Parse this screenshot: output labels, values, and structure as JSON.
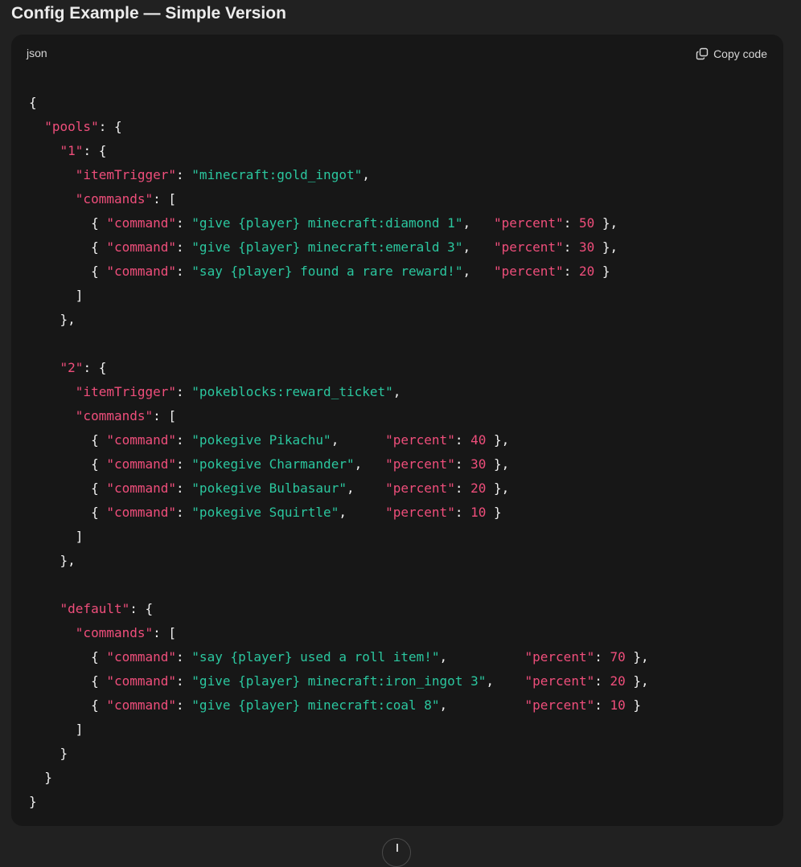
{
  "heading": "Config Example — Simple Version",
  "code_block": {
    "language": "json",
    "copy_label": "Copy code",
    "lines": [
      [
        {
          "t": "punc",
          "v": "{"
        }
      ],
      [
        {
          "t": "punc",
          "v": "  "
        },
        {
          "t": "key",
          "v": "\"pools\""
        },
        {
          "t": "punc",
          "v": ": {"
        }
      ],
      [
        {
          "t": "punc",
          "v": "    "
        },
        {
          "t": "key",
          "v": "\"1\""
        },
        {
          "t": "punc",
          "v": ": {"
        }
      ],
      [
        {
          "t": "punc",
          "v": "      "
        },
        {
          "t": "key",
          "v": "\"itemTrigger\""
        },
        {
          "t": "punc",
          "v": ": "
        },
        {
          "t": "str",
          "v": "\"minecraft:gold_ingot\""
        },
        {
          "t": "punc",
          "v": ","
        }
      ],
      [
        {
          "t": "punc",
          "v": "      "
        },
        {
          "t": "key",
          "v": "\"commands\""
        },
        {
          "t": "punc",
          "v": ": ["
        }
      ],
      [
        {
          "t": "punc",
          "v": "        { "
        },
        {
          "t": "key",
          "v": "\"command\""
        },
        {
          "t": "punc",
          "v": ": "
        },
        {
          "t": "str",
          "v": "\"give {player} minecraft:diamond 1\""
        },
        {
          "t": "punc",
          "v": ",   "
        },
        {
          "t": "key",
          "v": "\"percent\""
        },
        {
          "t": "punc",
          "v": ": "
        },
        {
          "t": "num",
          "v": "50"
        },
        {
          "t": "punc",
          "v": " },"
        }
      ],
      [
        {
          "t": "punc",
          "v": "        { "
        },
        {
          "t": "key",
          "v": "\"command\""
        },
        {
          "t": "punc",
          "v": ": "
        },
        {
          "t": "str",
          "v": "\"give {player} minecraft:emerald 3\""
        },
        {
          "t": "punc",
          "v": ",   "
        },
        {
          "t": "key",
          "v": "\"percent\""
        },
        {
          "t": "punc",
          "v": ": "
        },
        {
          "t": "num",
          "v": "30"
        },
        {
          "t": "punc",
          "v": " },"
        }
      ],
      [
        {
          "t": "punc",
          "v": "        { "
        },
        {
          "t": "key",
          "v": "\"command\""
        },
        {
          "t": "punc",
          "v": ": "
        },
        {
          "t": "str",
          "v": "\"say {player} found a rare reward!\""
        },
        {
          "t": "punc",
          "v": ",   "
        },
        {
          "t": "key",
          "v": "\"percent\""
        },
        {
          "t": "punc",
          "v": ": "
        },
        {
          "t": "num",
          "v": "20"
        },
        {
          "t": "punc",
          "v": " }"
        }
      ],
      [
        {
          "t": "punc",
          "v": "      ]"
        }
      ],
      [
        {
          "t": "punc",
          "v": "    },"
        }
      ],
      [
        {
          "t": "punc",
          "v": ""
        }
      ],
      [
        {
          "t": "punc",
          "v": "    "
        },
        {
          "t": "key",
          "v": "\"2\""
        },
        {
          "t": "punc",
          "v": ": {"
        }
      ],
      [
        {
          "t": "punc",
          "v": "      "
        },
        {
          "t": "key",
          "v": "\"itemTrigger\""
        },
        {
          "t": "punc",
          "v": ": "
        },
        {
          "t": "str",
          "v": "\"pokeblocks:reward_ticket\""
        },
        {
          "t": "punc",
          "v": ","
        }
      ],
      [
        {
          "t": "punc",
          "v": "      "
        },
        {
          "t": "key",
          "v": "\"commands\""
        },
        {
          "t": "punc",
          "v": ": ["
        }
      ],
      [
        {
          "t": "punc",
          "v": "        { "
        },
        {
          "t": "key",
          "v": "\"command\""
        },
        {
          "t": "punc",
          "v": ": "
        },
        {
          "t": "str",
          "v": "\"pokegive Pikachu\""
        },
        {
          "t": "punc",
          "v": ",      "
        },
        {
          "t": "key",
          "v": "\"percent\""
        },
        {
          "t": "punc",
          "v": ": "
        },
        {
          "t": "num",
          "v": "40"
        },
        {
          "t": "punc",
          "v": " },"
        }
      ],
      [
        {
          "t": "punc",
          "v": "        { "
        },
        {
          "t": "key",
          "v": "\"command\""
        },
        {
          "t": "punc",
          "v": ": "
        },
        {
          "t": "str",
          "v": "\"pokegive Charmander\""
        },
        {
          "t": "punc",
          "v": ",   "
        },
        {
          "t": "key",
          "v": "\"percent\""
        },
        {
          "t": "punc",
          "v": ": "
        },
        {
          "t": "num",
          "v": "30"
        },
        {
          "t": "punc",
          "v": " },"
        }
      ],
      [
        {
          "t": "punc",
          "v": "        { "
        },
        {
          "t": "key",
          "v": "\"command\""
        },
        {
          "t": "punc",
          "v": ": "
        },
        {
          "t": "str",
          "v": "\"pokegive Bulbasaur\""
        },
        {
          "t": "punc",
          "v": ",    "
        },
        {
          "t": "key",
          "v": "\"percent\""
        },
        {
          "t": "punc",
          "v": ": "
        },
        {
          "t": "num",
          "v": "20"
        },
        {
          "t": "punc",
          "v": " },"
        }
      ],
      [
        {
          "t": "punc",
          "v": "        { "
        },
        {
          "t": "key",
          "v": "\"command\""
        },
        {
          "t": "punc",
          "v": ": "
        },
        {
          "t": "str",
          "v": "\"pokegive Squirtle\""
        },
        {
          "t": "punc",
          "v": ",     "
        },
        {
          "t": "key",
          "v": "\"percent\""
        },
        {
          "t": "punc",
          "v": ": "
        },
        {
          "t": "num",
          "v": "10"
        },
        {
          "t": "punc",
          "v": " }"
        }
      ],
      [
        {
          "t": "punc",
          "v": "      ]"
        }
      ],
      [
        {
          "t": "punc",
          "v": "    },"
        }
      ],
      [
        {
          "t": "punc",
          "v": ""
        }
      ],
      [
        {
          "t": "punc",
          "v": "    "
        },
        {
          "t": "key",
          "v": "\"default\""
        },
        {
          "t": "punc",
          "v": ": {"
        }
      ],
      [
        {
          "t": "punc",
          "v": "      "
        },
        {
          "t": "key",
          "v": "\"commands\""
        },
        {
          "t": "punc",
          "v": ": ["
        }
      ],
      [
        {
          "t": "punc",
          "v": "        { "
        },
        {
          "t": "key",
          "v": "\"command\""
        },
        {
          "t": "punc",
          "v": ": "
        },
        {
          "t": "str",
          "v": "\"say {player} used a roll item!\""
        },
        {
          "t": "punc",
          "v": ",          "
        },
        {
          "t": "key",
          "v": "\"percent\""
        },
        {
          "t": "punc",
          "v": ": "
        },
        {
          "t": "num",
          "v": "70"
        },
        {
          "t": "punc",
          "v": " },"
        }
      ],
      [
        {
          "t": "punc",
          "v": "        { "
        },
        {
          "t": "key",
          "v": "\"command\""
        },
        {
          "t": "punc",
          "v": ": "
        },
        {
          "t": "str",
          "v": "\"give {player} minecraft:iron_ingot 3\""
        },
        {
          "t": "punc",
          "v": ",    "
        },
        {
          "t": "key",
          "v": "\"percent\""
        },
        {
          "t": "punc",
          "v": ": "
        },
        {
          "t": "num",
          "v": "20"
        },
        {
          "t": "punc",
          "v": " },"
        }
      ],
      [
        {
          "t": "punc",
          "v": "        { "
        },
        {
          "t": "key",
          "v": "\"command\""
        },
        {
          "t": "punc",
          "v": ": "
        },
        {
          "t": "str",
          "v": "\"give {player} minecraft:coal 8\""
        },
        {
          "t": "punc",
          "v": ",          "
        },
        {
          "t": "key",
          "v": "\"percent\""
        },
        {
          "t": "punc",
          "v": ": "
        },
        {
          "t": "num",
          "v": "10"
        },
        {
          "t": "punc",
          "v": " }"
        }
      ],
      [
        {
          "t": "punc",
          "v": "      ]"
        }
      ],
      [
        {
          "t": "punc",
          "v": "    }"
        }
      ],
      [
        {
          "t": "punc",
          "v": "  }"
        }
      ],
      [
        {
          "t": "punc",
          "v": "}"
        }
      ]
    ]
  },
  "colors": {
    "background": "#212121",
    "code_background": "#171717",
    "key": "#ef4e7b",
    "string": "#2bc79f",
    "number": "#ef4e7b",
    "punctuation": "#f0f0f0"
  },
  "icons": {
    "copy": "copy-icon",
    "scroll": "arrow-down-icon"
  }
}
